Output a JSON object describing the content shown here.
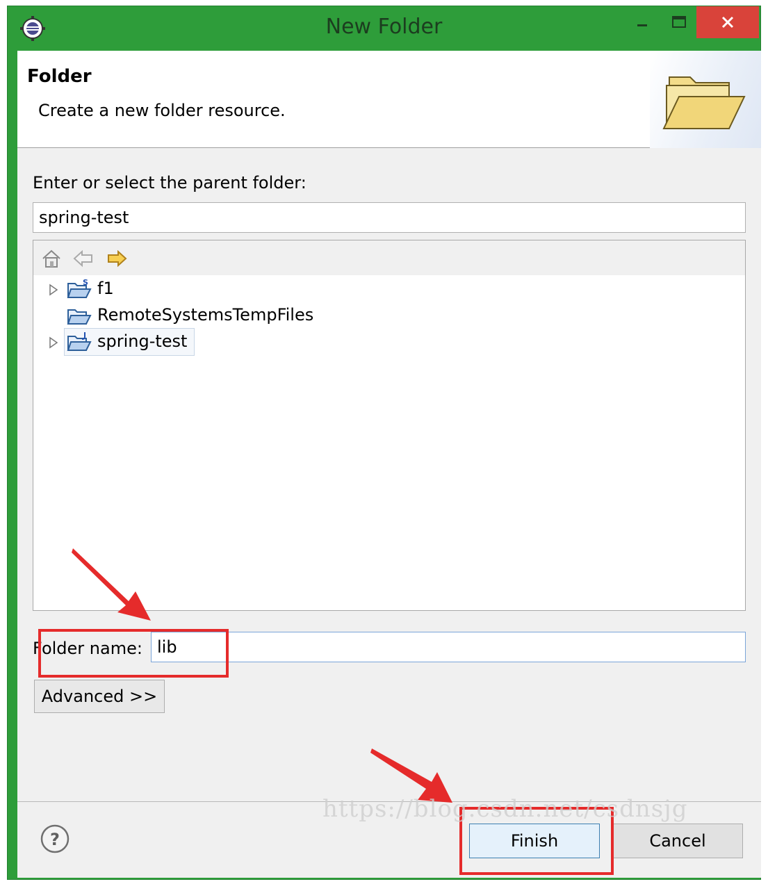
{
  "window": {
    "title": "New Folder"
  },
  "header": {
    "title": "Folder",
    "description": "Create a new folder resource."
  },
  "parent_folder": {
    "label": "Enter or select the parent folder:",
    "value": "spring-test"
  },
  "tree": {
    "toolbar_icons": [
      "home-icon",
      "back-arrow-icon",
      "forward-arrow-icon"
    ],
    "items": [
      {
        "label": "f1",
        "expandable": true
      },
      {
        "label": "RemoteSystemsTempFiles",
        "expandable": false
      },
      {
        "label": "spring-test",
        "expandable": true,
        "selected": true
      }
    ]
  },
  "folder_name": {
    "label": "Folder name:",
    "value": "lib"
  },
  "buttons": {
    "advanced": "Advanced >>",
    "finish": "Finish",
    "cancel": "Cancel"
  },
  "watermark": "https://blog.csdn.net/csdnsjg",
  "colors": {
    "title_bar": "#2e9d3a",
    "close_button": "#d9433a",
    "highlight": "#e52b2b"
  }
}
